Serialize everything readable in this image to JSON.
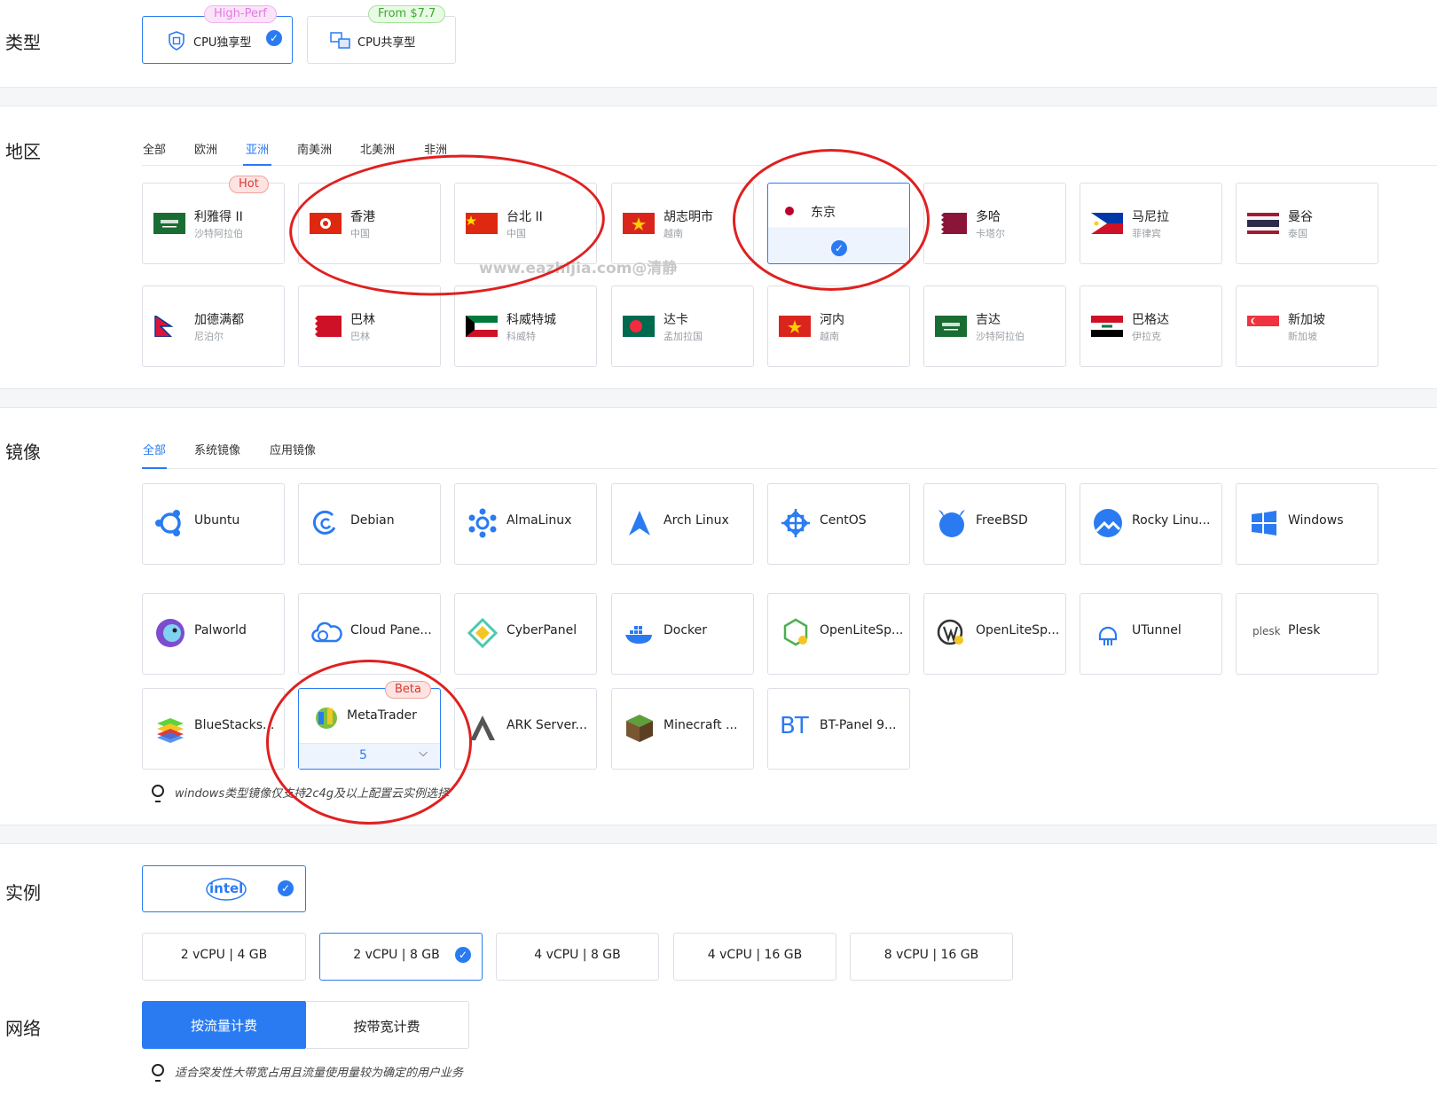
{
  "type_section": {
    "label": "类型",
    "options": [
      {
        "label": "CPU独享型",
        "badge": "High-Perf",
        "selected": true
      },
      {
        "label": "CPU共享型",
        "badge": "From $7.7",
        "selected": false
      }
    ]
  },
  "region_section": {
    "label": "地区",
    "tabs": [
      "全部",
      "欧洲",
      "亚洲",
      "南美洲",
      "北美洲",
      "非洲"
    ],
    "active_tab": "亚洲",
    "regions": [
      {
        "name": "利雅得 II",
        "country": "沙特阿拉伯",
        "badge": "Hot"
      },
      {
        "name": "香港",
        "country": "中国"
      },
      {
        "name": "台北 II",
        "country": "中国"
      },
      {
        "name": "胡志明市",
        "country": "越南"
      },
      {
        "name": "东京",
        "country": "",
        "selected": true
      },
      {
        "name": "多哈",
        "country": "卡塔尔"
      },
      {
        "name": "马尼拉",
        "country": "菲律宾"
      },
      {
        "name": "曼谷",
        "country": "泰国"
      },
      {
        "name": "加德满都",
        "country": "尼泊尔"
      },
      {
        "name": "巴林",
        "country": "巴林"
      },
      {
        "name": "科威特城",
        "country": "科威特"
      },
      {
        "name": "达卡",
        "country": "孟加拉国"
      },
      {
        "name": "河内",
        "country": "越南"
      },
      {
        "name": "吉达",
        "country": "沙特阿拉伯"
      },
      {
        "name": "巴格达",
        "country": "伊拉克"
      },
      {
        "name": "新加坡",
        "country": "新加坡"
      }
    ]
  },
  "watermark": "www.eazhijia.com@清静",
  "image_section": {
    "label": "镜像",
    "tabs": [
      "全部",
      "系统镜像",
      "应用镜像"
    ],
    "active_tab": "全部",
    "os_images": [
      "Ubuntu",
      "Debian",
      "AlmaLinux",
      "Arch Linux",
      "CentOS",
      "FreeBSD",
      "Rocky Linu...",
      "Windows"
    ],
    "app_images": [
      "Palworld",
      "Cloud Pane...",
      "CyberPanel",
      "Docker",
      "OpenLiteSp...",
      "OpenLiteSp...",
      "UTunnel",
      "Plesk"
    ],
    "plesk_logo_text": "plesk",
    "app_images_row3": [
      "BlueStacks...",
      "MetaTrader",
      "ARK Server...",
      "Minecraft ...",
      "BT-Panel 9..."
    ],
    "bt_logo_text": "BT",
    "metatrader": {
      "badge": "Beta",
      "version": "5"
    },
    "tip": "windows类型镜像仅支持2c4g及以上配置云实例选择"
  },
  "instance_section": {
    "label": "实例",
    "vendor": "intel",
    "specs": [
      "2 vCPU | 4 GB",
      "2 vCPU | 8 GB",
      "4 vCPU | 8 GB",
      "4 vCPU | 16 GB",
      "8 vCPU | 16 GB"
    ],
    "selected_spec": "2 vCPU | 8 GB"
  },
  "network_section": {
    "label": "网络",
    "options": [
      "按流量计费",
      "按带宽计费"
    ],
    "selected": "按流量计费",
    "tip": "适合突发性大带宽占用且流量使用量较为确定的用户业务"
  },
  "colors": {
    "accent": "#2a7bf2",
    "annotation": "#e02020",
    "hot": "#e53935"
  }
}
